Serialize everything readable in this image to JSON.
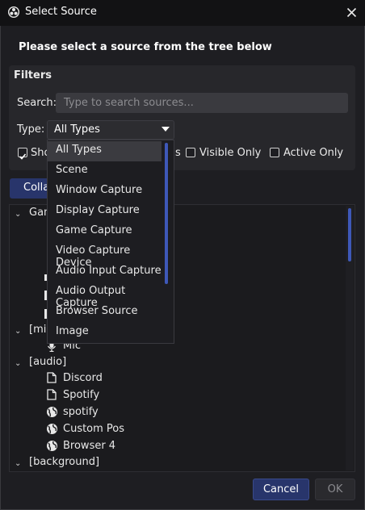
{
  "window": {
    "title": "Select Source"
  },
  "heading": "Please select a source from the tree below",
  "filters": {
    "title": "Filters",
    "search_label": "Search:",
    "search_placeholder": "Type to search sources...",
    "type_label": "Type:",
    "type_value": "All Types",
    "show_checkbox_label": "Sho",
    "partial_label": "s",
    "visible_only_label": "Visible Only",
    "active_only_label": "Active Only",
    "show_checked": true,
    "visible_only_checked": false,
    "active_only_checked": false
  },
  "collapse_button": "Colla",
  "dropdown": {
    "options": [
      "All Types",
      "Scene",
      "Window Capture",
      "Display Capture",
      "Game Capture",
      "Video Capture Device",
      "Audio Input Capture",
      "Audio Output Capture",
      "Browser Source",
      "Image"
    ],
    "selected": "All Types"
  },
  "tree": {
    "groups": [
      {
        "label": "Gan",
        "items": []
      },
      {
        "label": "[mic",
        "items": [
          {
            "label": "Mic",
            "icon": "mic-icon"
          }
        ]
      },
      {
        "label": "[audio]",
        "items": [
          {
            "label": "Discord",
            "icon": "file-icon"
          },
          {
            "label": "Spotify",
            "icon": "file-icon"
          },
          {
            "label": "spotify",
            "icon": "globe-icon"
          },
          {
            "label": "Custom Pos",
            "icon": "globe-icon"
          },
          {
            "label": "Browser 4",
            "icon": "globe-icon"
          }
        ]
      },
      {
        "label": "[background]",
        "items": []
      }
    ]
  },
  "buttons": {
    "cancel": "Cancel",
    "ok": "OK"
  },
  "colors": {
    "accent": "#28356b",
    "scroll_accent": "#3e58b8",
    "background": "#1e1e22"
  }
}
